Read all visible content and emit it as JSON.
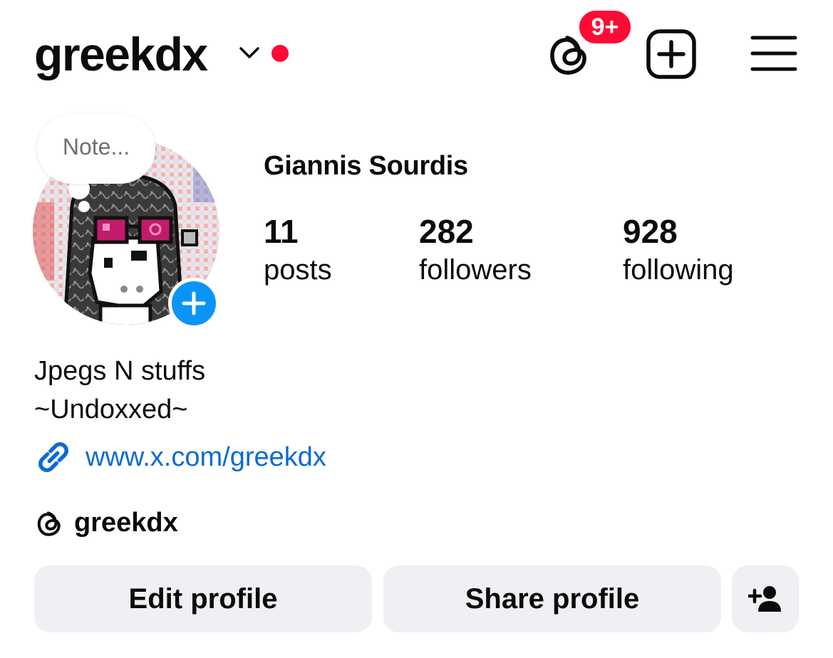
{
  "header": {
    "username": "greekdx",
    "notification_badge": "9+",
    "accent_red": "#ff0a35",
    "icons": [
      "chevron-down-icon",
      "threads-icon",
      "new-post-icon",
      "menu-icon"
    ]
  },
  "profile": {
    "note_placeholder": "Note...",
    "full_name": "Giannis Sourdis",
    "stats": {
      "posts": {
        "value": "11",
        "label": "posts"
      },
      "followers": {
        "value": "282",
        "label": "followers"
      },
      "following": {
        "value": "928",
        "label": "following"
      }
    },
    "bio_lines": [
      "Jpegs N stuffs",
      "~Undoxxed~"
    ],
    "link": "www.x.com/greekdx",
    "threads_handle": "greekdx",
    "link_color": "#0a6bd1",
    "add_story_color": "#0a95f6"
  },
  "actions": {
    "edit_label": "Edit profile",
    "share_label": "Share profile",
    "discover_icon": "add-person-icon"
  }
}
